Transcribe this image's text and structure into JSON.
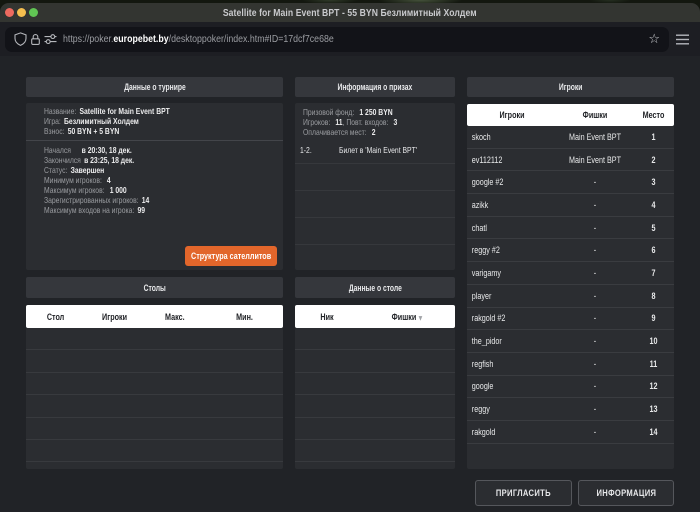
{
  "window": {
    "title": "Satellite for Main Event BPT - 55 BYN Безлимитный Холдем"
  },
  "browser": {
    "url_prefix": "https://poker.",
    "url_domain": "europebet.by",
    "url_path": "/desktoppoker/index.htm#ID=17dcf7ce68e"
  },
  "colors": {
    "accent_orange": "#e2662b"
  },
  "tournament": {
    "header": "Данные о турнире",
    "blocks": [
      [
        [
          "Название:",
          "Satellite for Main Event BPT"
        ],
        [
          "Игра:",
          "Безлимитный Холдем"
        ],
        [
          "Взнос:",
          "50 BYN + 5 BYN"
        ]
      ],
      [
        [
          "Начался    ",
          "в 20:30, 18 дек."
        ],
        [
          "Закончился",
          "в 23:25, 18 дек."
        ],
        [
          "Статус:",
          "Завершен"
        ],
        [
          "Минимум игроков: ",
          "4"
        ],
        [
          "Максимум игроков: ",
          "1 000"
        ],
        [
          "Зарегистрированных игроков:",
          "14"
        ],
        [
          "Максимум входов на игрока:",
          "99"
        ]
      ]
    ],
    "structure_button": "Структура сателлитов"
  },
  "prizes": {
    "header": "Информация о призах",
    "info_lines": [
      [
        [
          "Призовой фонд: ",
          0
        ],
        [
          "1 250 BYN",
          1
        ]
      ],
      [
        [
          "Игроков: ",
          0
        ],
        [
          "11",
          1
        ],
        [
          ", Повт. входов: ",
          0
        ],
        [
          "3",
          1
        ]
      ],
      [
        [
          "Оплачивается мест: ",
          0
        ],
        [
          "2",
          1
        ]
      ]
    ],
    "rows": [
      {
        "rank": "1-2.",
        "prize": "Билет в 'Main Event BPT'"
      }
    ],
    "empty_rows": 4
  },
  "players": {
    "header": "Игроки",
    "columns": [
      "Игроки",
      "Фишки",
      "Место"
    ],
    "rows": [
      {
        "name": "skoch",
        "chips": "Main Event BPT",
        "place": "1"
      },
      {
        "name": "ev112112",
        "chips": "Main Event BPT",
        "place": "2"
      },
      {
        "name": "google #2",
        "chips": "-",
        "place": "3"
      },
      {
        "name": "azikk",
        "chips": "-",
        "place": "4"
      },
      {
        "name": "chatl",
        "chips": "-",
        "place": "5"
      },
      {
        "name": "reggy #2",
        "chips": "-",
        "place": "6"
      },
      {
        "name": "varigamy",
        "chips": "-",
        "place": "7"
      },
      {
        "name": "player",
        "chips": "-",
        "place": "8"
      },
      {
        "name": "rakgold #2",
        "chips": "-",
        "place": "9"
      },
      {
        "name": "the_pidor",
        "chips": "-",
        "place": "10"
      },
      {
        "name": "regfish",
        "chips": "-",
        "place": "11"
      },
      {
        "name": "google",
        "chips": "-",
        "place": "12"
      },
      {
        "name": "reggy",
        "chips": "-",
        "place": "13"
      },
      {
        "name": "rakgold",
        "chips": "-",
        "place": "14"
      }
    ]
  },
  "tables": {
    "header": "Столы",
    "columns": [
      "Стол",
      "Игроки",
      "Макс.",
      "Мин."
    ],
    "empty_rows": 7
  },
  "table_info": {
    "header": "Данные о столе",
    "columns": [
      "Ник",
      "Фишки"
    ],
    "empty_rows": 7
  },
  "actions": {
    "invite": "ПРИГЛАСИТЬ",
    "info": "ИНФОРМАЦИЯ"
  }
}
